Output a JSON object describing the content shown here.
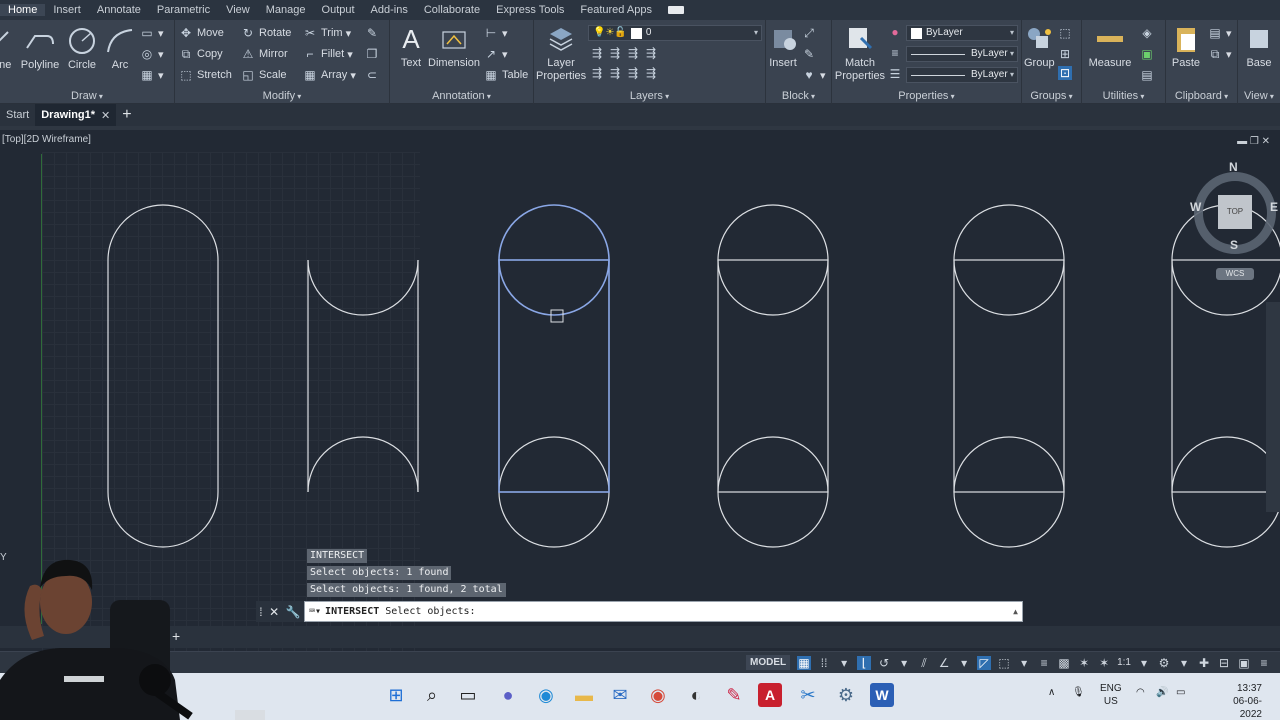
{
  "ribbon_tabs": [
    "Home",
    "Insert",
    "Annotate",
    "Parametric",
    "View",
    "Manage",
    "Output",
    "Add-ins",
    "Collaborate",
    "Express Tools",
    "Featured Apps"
  ],
  "ribbon": {
    "draw": {
      "title": "Draw",
      "line": "Line",
      "polyline": "Polyline",
      "circle": "Circle",
      "arc": "Arc"
    },
    "modify": {
      "title": "Modify",
      "move": "Move",
      "rotate": "Rotate",
      "trim": "Trim",
      "copy": "Copy",
      "mirror": "Mirror",
      "fillet": "Fillet",
      "stretch": "Stretch",
      "scale": "Scale",
      "array": "Array"
    },
    "annotation": {
      "title": "Annotation",
      "text": "Text",
      "dimension": "Dimension",
      "table": "Table"
    },
    "layers": {
      "title": "Layers",
      "layer_properties": "Layer Properties",
      "current_layer": "0"
    },
    "block": {
      "title": "Block",
      "insert": "Insert"
    },
    "properties": {
      "title": "Properties",
      "match": "Match Properties",
      "color": "ByLayer",
      "linetype": "ByLayer",
      "lineweight": "ByLayer"
    },
    "groups": {
      "title": "Groups",
      "group": "Group"
    },
    "utilities": {
      "title": "Utilities",
      "measure": "Measure"
    },
    "clipboard": {
      "title": "Clipboard",
      "paste": "Paste"
    },
    "view": {
      "title": "View",
      "base": "Base"
    }
  },
  "file_tabs": {
    "start": "Start",
    "drawing": "Drawing1*",
    "plus": "+"
  },
  "viewport_label": "[Top][2D Wireframe]",
  "viewcube": {
    "n": "N",
    "s": "S",
    "e": "E",
    "w": "W",
    "face": "TOP",
    "wcs": "WCS"
  },
  "ucs_label": "Y",
  "command_history": [
    "INTERSECT",
    "Select objects: 1 found",
    "Select objects: 1 found, 2 total"
  ],
  "command_line": {
    "command": "INTERSECT",
    "prompt": "Select objects:"
  },
  "status_bar": {
    "model": "MODEL",
    "scale": "1:1"
  },
  "taskbar": {
    "lang_top": "ENG",
    "lang_bottom": "US",
    "time": "13:37",
    "date": "06-06-2022"
  }
}
